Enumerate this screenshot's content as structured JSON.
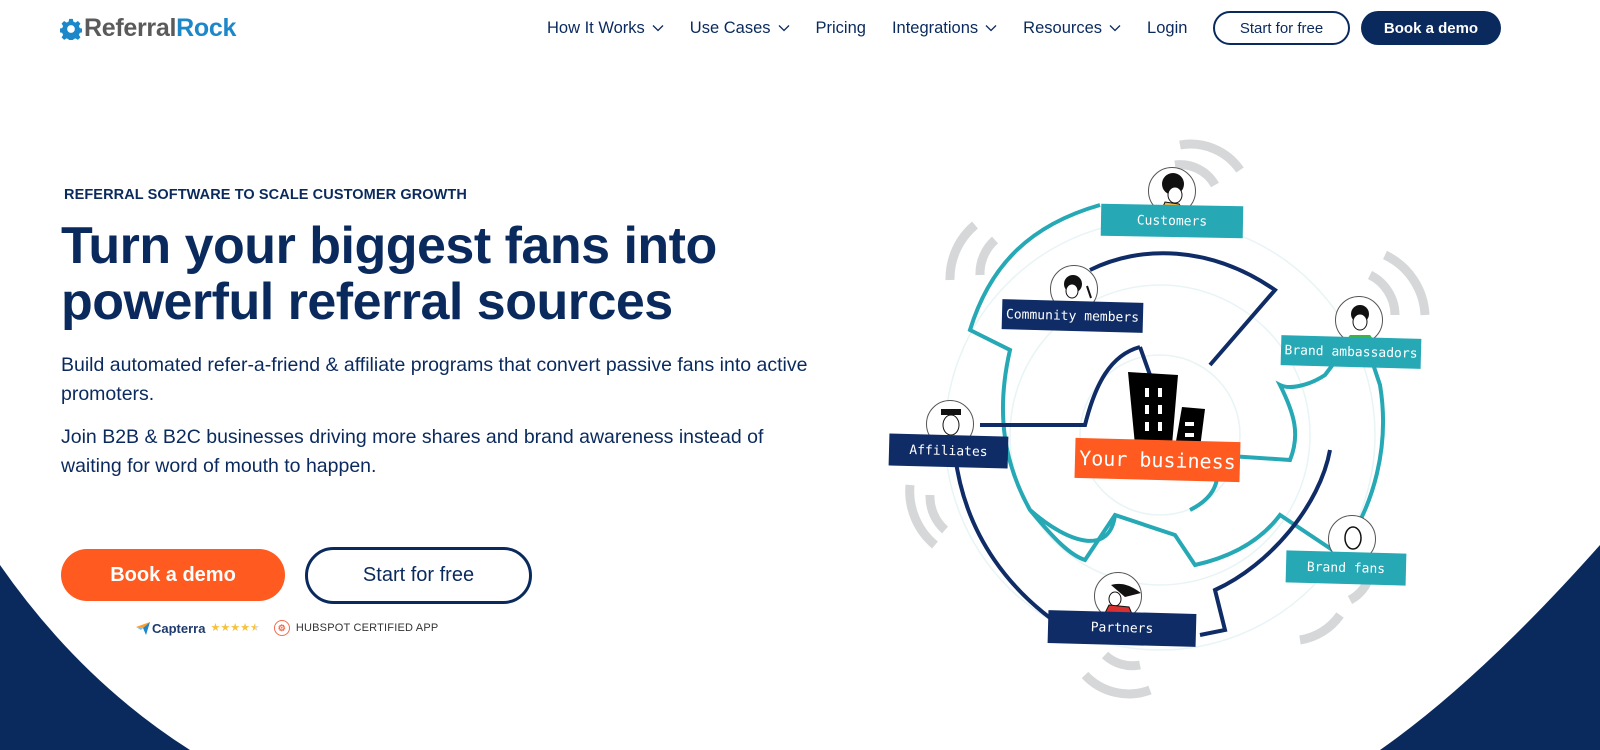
{
  "header": {
    "logo": {
      "part1": "Referral",
      "part2": "Rock",
      "icon": "gear-icon"
    },
    "nav": [
      {
        "label": "How It Works",
        "has_dropdown": true
      },
      {
        "label": "Use Cases",
        "has_dropdown": true
      },
      {
        "label": "Pricing",
        "has_dropdown": false
      },
      {
        "label": "Integrations",
        "has_dropdown": true
      },
      {
        "label": "Resources",
        "has_dropdown": true
      },
      {
        "label": "Login",
        "has_dropdown": false
      }
    ],
    "start_free_label": "Start for free",
    "book_demo_label": "Book a demo"
  },
  "hero": {
    "eyebrow": "REFERRAL SOFTWARE TO SCALE CUSTOMER GROWTH",
    "headline_line1": "Turn your biggest fans into",
    "headline_line2": "powerful referral sources",
    "paragraph1": "Build automated refer-a-friend & affiliate programs that convert passive fans into active promoters.",
    "paragraph2": "Join B2B & B2C businesses driving more shares and brand awareness instead of waiting for word of mouth to happen.",
    "cta_primary": "Book a demo",
    "cta_secondary": "Start for free",
    "badges": {
      "capterra_label": "Capterra",
      "capterra_rating": 4.5,
      "capterra_max": 5,
      "hubspot_label": "HUBSPOT CERTIFIED APP"
    }
  },
  "illustration": {
    "center_label": "Your business",
    "nodes": [
      {
        "label": "Customers",
        "style": "teal"
      },
      {
        "label": "Community members",
        "style": "navy"
      },
      {
        "label": "Brand ambassadors",
        "style": "teal"
      },
      {
        "label": "Affiliates",
        "style": "navy"
      },
      {
        "label": "Brand fans",
        "style": "teal"
      },
      {
        "label": "Partners",
        "style": "navy"
      }
    ]
  },
  "colors": {
    "navy": "#0a2a5e",
    "orange": "#ff5a1f",
    "teal": "#26a8b5",
    "logo_blue": "#1c87c9",
    "star": "#f7c23b"
  }
}
